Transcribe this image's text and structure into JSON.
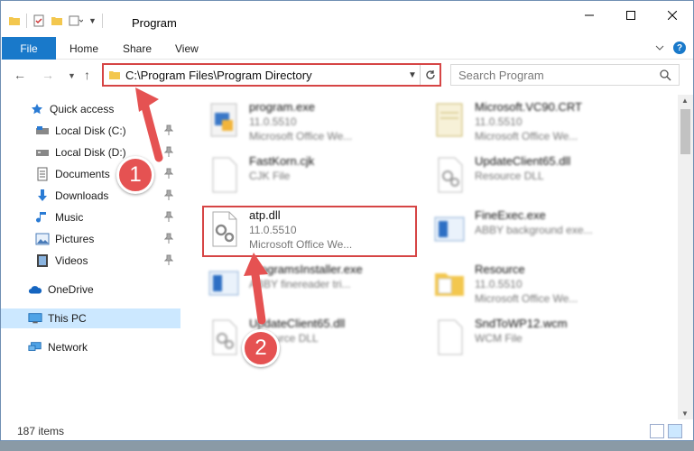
{
  "window": {
    "title": "Program"
  },
  "ribbon": {
    "file": "File",
    "home": "Home",
    "share": "Share",
    "view": "View"
  },
  "address": {
    "path": "C:\\Program Files\\Program Directory",
    "search_placeholder": "Search Program"
  },
  "sidebar": {
    "items": [
      {
        "label": "Quick access",
        "icon": "star-icon"
      },
      {
        "label": "Local Disk (C:)",
        "icon": "drive-icon"
      },
      {
        "label": "Local Disk (D:)",
        "icon": "drive-icon"
      },
      {
        "label": "Documents",
        "icon": "documents-icon"
      },
      {
        "label": "Downloads",
        "icon": "download-icon"
      },
      {
        "label": "Music",
        "icon": "music-icon"
      },
      {
        "label": "Pictures",
        "icon": "pictures-icon"
      },
      {
        "label": "Videos",
        "icon": "videos-icon"
      },
      {
        "label": "OneDrive",
        "icon": "cloud-icon"
      },
      {
        "label": "This PC",
        "icon": "computer-icon"
      },
      {
        "label": "Network",
        "icon": "network-icon"
      }
    ]
  },
  "files": {
    "f1": {
      "name": "program.exe",
      "line2": "11.0.5510",
      "line3": "Microsoft Office We..."
    },
    "f2": {
      "name": "Microsoft.VC90.CRT",
      "line2": "11.0.5510",
      "line3": "Microsoft Office We..."
    },
    "f3": {
      "name": "FastKorn.cjk",
      "line2": "CJK File"
    },
    "f4": {
      "name": "UpdateClient65.dll",
      "line2": "Resource DLL"
    },
    "f5": {
      "name": "atp.dll",
      "line2": "11.0.5510",
      "line3": "Microsoft Office We..."
    },
    "f6": {
      "name": "FineExec.exe",
      "line2": "ABBY background exe..."
    },
    "f7": {
      "name": "ProgramsInstaller.exe",
      "line2": "ABBY finereader tri..."
    },
    "f8": {
      "name": "Resource",
      "line2": "11.0.5510",
      "line3": "Microsoft Office We..."
    },
    "f9": {
      "name": "UpdateClient65.dll",
      "line2": "Resource DLL"
    },
    "f10": {
      "name": "SndToWP12.wcm",
      "line2": "WCM File"
    }
  },
  "status": {
    "count": "187 items"
  },
  "callouts": {
    "one": "1",
    "two": "2"
  },
  "colors": {
    "accent": "#1979ca",
    "highlight_red": "#d64545",
    "badge_red": "#e55252"
  }
}
